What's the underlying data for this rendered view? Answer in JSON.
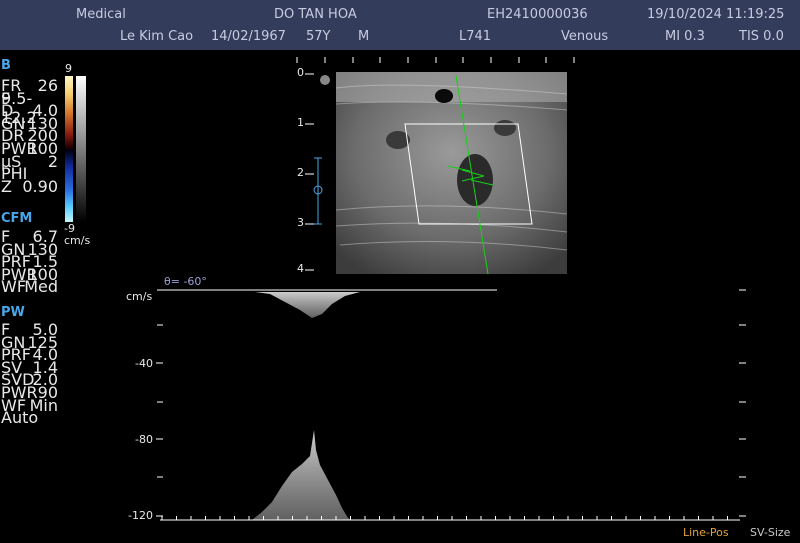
{
  "header": {
    "institution": "Medical",
    "patient_id_name": "DO TAN HOA",
    "exam_id": "EH2410000036",
    "datetime": "19/10/2024 11:19:25",
    "operator": "Le Kim Cao",
    "dob": "14/02/1967",
    "age": "57Y",
    "sex": "M",
    "probe": "L741",
    "preset": "Venous",
    "mi": "MI 0.3",
    "tis": "TIS 0.0"
  },
  "b_params": {
    "title": "B",
    "rows": [
      {
        "k": "FR",
        "v": "26"
      },
      {
        "k": "F",
        "v": "9.5-12.2"
      },
      {
        "k": "D",
        "v": "4.0"
      },
      {
        "k": "GN",
        "v": "130"
      },
      {
        "k": "DR",
        "v": "200"
      },
      {
        "k": "PWR",
        "v": "100"
      },
      {
        "k": "µS",
        "v": "2"
      },
      {
        "k": "PHI",
        "v": ""
      },
      {
        "k": "Z",
        "v": "0.90"
      }
    ]
  },
  "cfm_params": {
    "title": "CFM",
    "rows": [
      {
        "k": "F",
        "v": "6.7"
      },
      {
        "k": "GN",
        "v": "130"
      },
      {
        "k": "PRF",
        "v": "1.5"
      },
      {
        "k": "PWR",
        "v": "100"
      },
      {
        "k": "WF",
        "v": "Med"
      }
    ]
  },
  "pw_params": {
    "title": "PW",
    "rows": [
      {
        "k": "F",
        "v": "5.0"
      },
      {
        "k": "GN",
        "v": "125"
      },
      {
        "k": "PRF",
        "v": "4.0"
      },
      {
        "k": "SV",
        "v": "1.4"
      },
      {
        "k": "SVD",
        "v": "2.0"
      },
      {
        "k": "PWR",
        "v": "90"
      },
      {
        "k": "WF",
        "v": "Min"
      },
      {
        "k": "Auto",
        "v": ""
      }
    ]
  },
  "color_bar": {
    "top": "9",
    "bottom": "-9",
    "unit": "cm/s"
  },
  "depth_scale": [
    "0",
    "1",
    "2",
    "3",
    "4"
  ],
  "spectral": {
    "unit": "cm/s",
    "angle": "θ= -60°",
    "ticks": [
      "-40",
      "-80",
      "-120"
    ]
  },
  "footer": {
    "line_pos": "Line-Pos",
    "sv_size": "SV-Size"
  },
  "colors": {
    "header_bg": "#343c5c",
    "accent": "#4aa6e8",
    "footer_accent": "#e2a23a"
  }
}
